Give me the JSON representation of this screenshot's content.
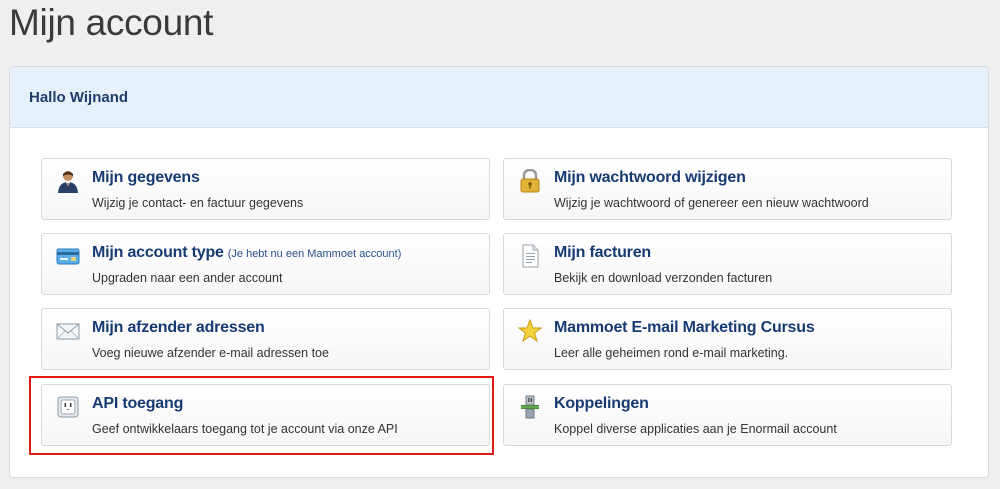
{
  "page": {
    "title": "Mijn account"
  },
  "panel": {
    "greeting": "Hallo Wijnand"
  },
  "tiles": [
    {
      "title": "Mijn gegevens",
      "note": "",
      "desc": "Wijzig je contact- en factuur gegevens",
      "icon": "user-icon"
    },
    {
      "title": "Mijn wachtwoord wijzigen",
      "note": "",
      "desc": "Wijzig je wachtwoord of genereer een nieuw wachtwoord",
      "icon": "lock-icon"
    },
    {
      "title": "Mijn account type",
      "note": "(Je hebt nu een Mammoet account)",
      "desc": "Upgraden naar een ander account",
      "icon": "credit-card-icon"
    },
    {
      "title": "Mijn facturen",
      "note": "",
      "desc": "Bekijk en download verzonden facturen",
      "icon": "document-icon"
    },
    {
      "title": "Mijn afzender adressen",
      "note": "",
      "desc": "Voeg nieuwe afzender e-mail adressen toe",
      "icon": "envelope-icon"
    },
    {
      "title": "Mammoet E-mail Marketing Cursus",
      "note": "",
      "desc": "Leer alle geheimen rond e-mail marketing.",
      "icon": "star-icon"
    },
    {
      "title": "API toegang",
      "note": "",
      "desc": "Geef ontwikkelaars toegang tot je account via onze API",
      "icon": "power-socket-icon"
    },
    {
      "title": "Koppelingen",
      "note": "",
      "desc": "Koppel diverse applicaties aan je Enormail account",
      "icon": "connector-icon"
    }
  ],
  "colors": {
    "title_text": "#173a73",
    "header_bg": "#e6f0fb",
    "highlight": "#e01818"
  }
}
